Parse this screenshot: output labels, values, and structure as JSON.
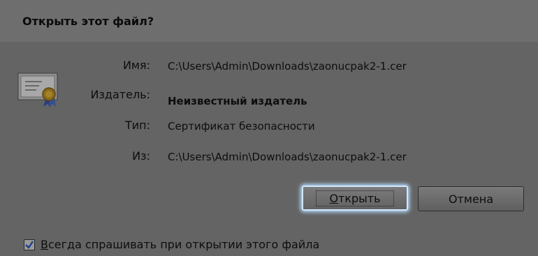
{
  "dialog": {
    "title": "Открыть этот файл?"
  },
  "fields": {
    "name_label": "Имя:",
    "name_value": "C:\\Users\\Admin\\Downloads\\zaonucpak2-1.cer",
    "publisher_label": "Издатель:",
    "publisher_value": "Неизвестный издатель",
    "type_label": "Тип:",
    "type_value": "Сертификат безопасности",
    "from_label": "Из:",
    "from_value": "C:\\Users\\Admin\\Downloads\\zaonucpak2-1.cer"
  },
  "buttons": {
    "open_accel": "О",
    "open_rest": "ткрыть",
    "cancel": "Отмена"
  },
  "checkbox": {
    "checked": true,
    "label_accel": "В",
    "label_rest": "сегда спрашивать при открытии этого файла"
  },
  "icons": {
    "file_icon": "certificate-icon",
    "check": "checkmark-icon"
  },
  "colors": {
    "background": "#646464",
    "focus_glow": "#b8dcff"
  }
}
